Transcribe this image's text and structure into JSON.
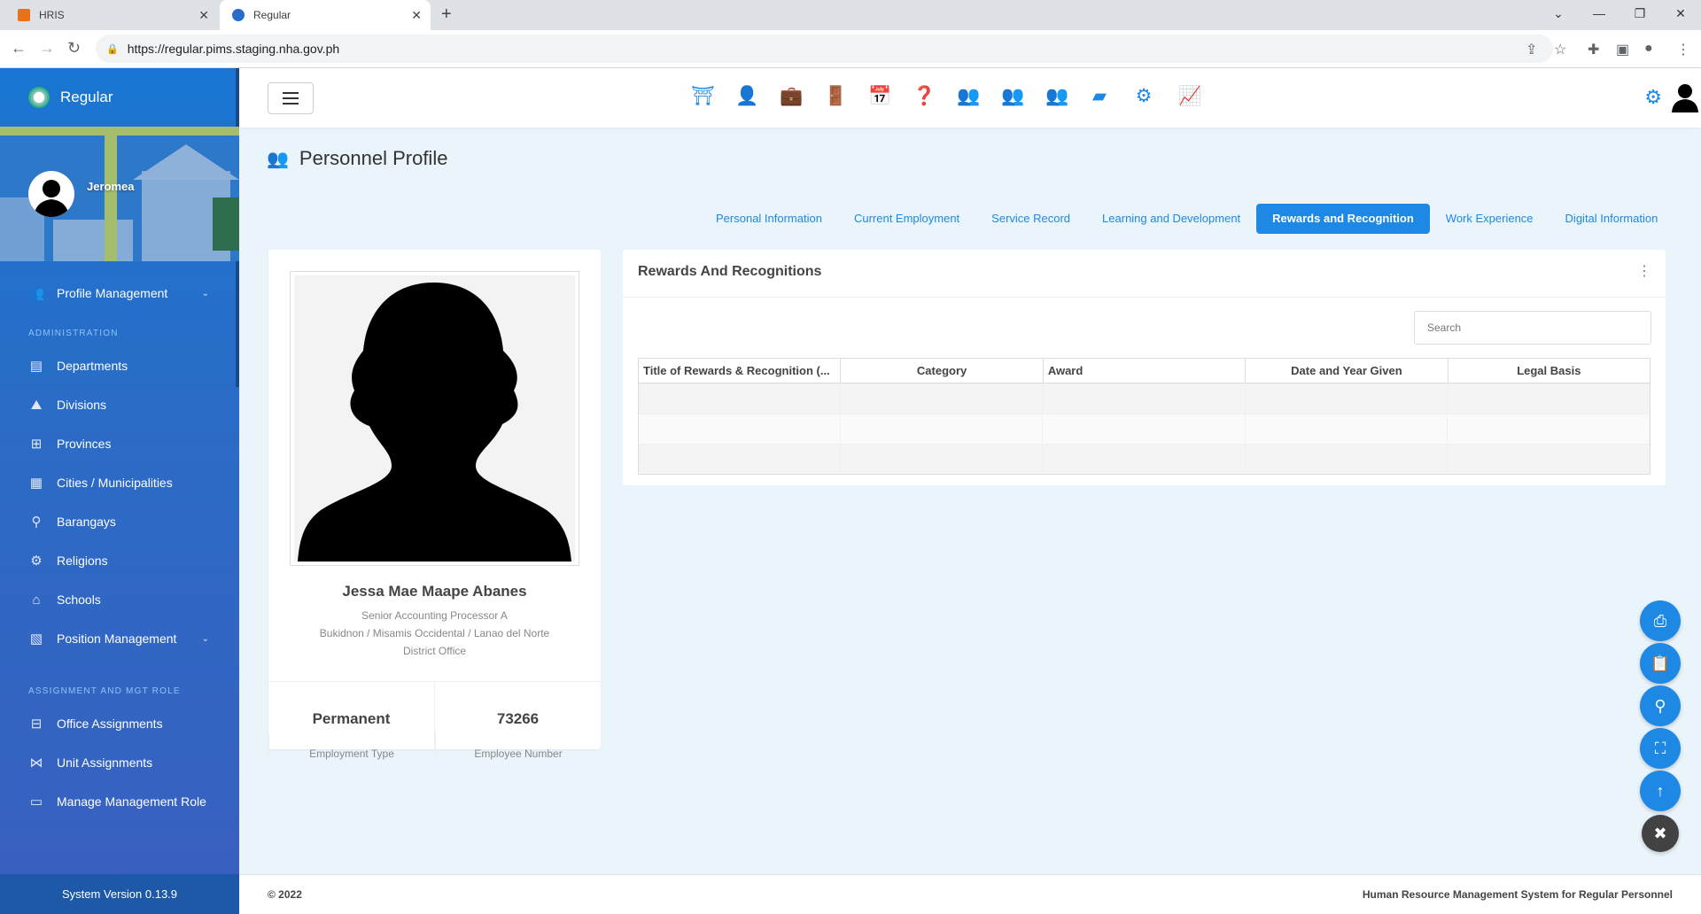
{
  "browser": {
    "tabs": [
      {
        "label": "HRIS"
      },
      {
        "label": "Regular"
      }
    ],
    "url": "https://regular.pims.staging.nha.gov.ph"
  },
  "sidebar": {
    "brand": "Regular",
    "user_name": "Jeromea",
    "items": [
      {
        "label": "Profile Management",
        "icon": "users-icon"
      }
    ],
    "sections": [
      {
        "title": "ADMINISTRATION",
        "items": [
          {
            "label": "Departments",
            "icon": "building-icon"
          },
          {
            "label": "Divisions",
            "icon": "chart-icon"
          },
          {
            "label": "Provinces",
            "icon": "map-icon"
          },
          {
            "label": "Cities / Municipalities",
            "icon": "city-icon"
          },
          {
            "label": "Barangays",
            "icon": "pin-icon"
          },
          {
            "label": "Religions",
            "icon": "cog-icon"
          },
          {
            "label": "Schools",
            "icon": "school-icon"
          },
          {
            "label": "Position Management",
            "icon": "position-icon"
          }
        ]
      },
      {
        "title": "ASSIGNMENT AND MGT ROLE",
        "items": [
          {
            "label": "Office Assignments",
            "icon": "org-icon"
          },
          {
            "label": "Unit Assignments",
            "icon": "network-icon"
          },
          {
            "label": "Manage Management Role",
            "icon": "id-card-icon"
          }
        ]
      }
    ],
    "version": "System Version 0.13.9"
  },
  "page": {
    "title": "Personnel Profile",
    "tabs": [
      {
        "label": "Personal Information"
      },
      {
        "label": "Current Employment"
      },
      {
        "label": "Service Record"
      },
      {
        "label": "Learning and Development"
      },
      {
        "label": "Rewards and Recognition",
        "active": true
      },
      {
        "label": "Work Experience"
      },
      {
        "label": "Digital Information"
      }
    ]
  },
  "profile": {
    "name": "Jessa Mae Maape Abanes",
    "position": "Senior Accounting Processor A",
    "office_line1": "Bukidnon / Misamis Occidental / Lanao del Norte",
    "office_line2": "District Office",
    "employment_type_value": "Permanent",
    "employment_type_label": "Employment Type",
    "employee_number_value": "73266",
    "employee_number_label": "Employee Number"
  },
  "rewards": {
    "title": "Rewards And Recognitions",
    "search_placeholder": "Search",
    "columns": [
      "Title of Rewards & Recognition (...",
      "Category",
      "Award",
      "Date and Year Given",
      "Legal Basis"
    ],
    "rows": []
  },
  "footer": {
    "copyright": "© 2022",
    "system_name": "Human Resource Management System for Regular Personnel"
  },
  "colors": {
    "accent": "#1e88e5",
    "sidebar": "#1976d2"
  }
}
